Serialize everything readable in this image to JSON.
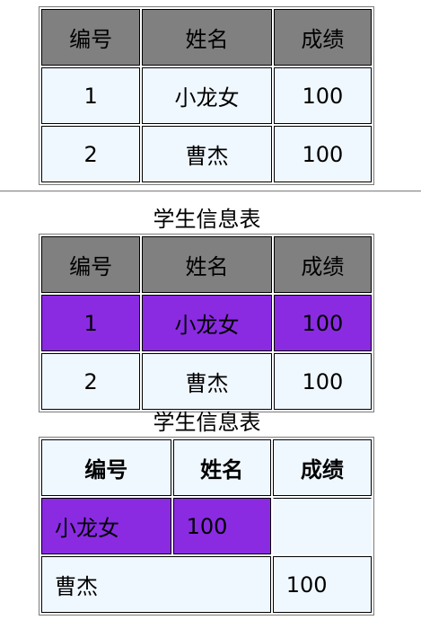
{
  "table1": {
    "headers": [
      "编号",
      "姓名",
      "成绩"
    ],
    "rows": [
      [
        "1",
        "小龙女",
        "100"
      ],
      [
        "2",
        "曹杰",
        "100"
      ]
    ]
  },
  "table2": {
    "caption": "学生信息表",
    "headers": [
      "编号",
      "姓名",
      "成绩"
    ],
    "rows": [
      [
        "1",
        "小龙女",
        "100"
      ],
      [
        "2",
        "曹杰",
        "100"
      ]
    ]
  },
  "table3": {
    "caption": "学生信息表",
    "headers": [
      "编号",
      "姓名",
      "成绩"
    ],
    "rows": [
      [
        "小龙女",
        "100"
      ],
      [
        "曹杰",
        "100"
      ]
    ]
  },
  "colors": {
    "header_gray": "#808080",
    "row_light": "#f0f8ff",
    "row_highlight": "#8a2be2"
  }
}
